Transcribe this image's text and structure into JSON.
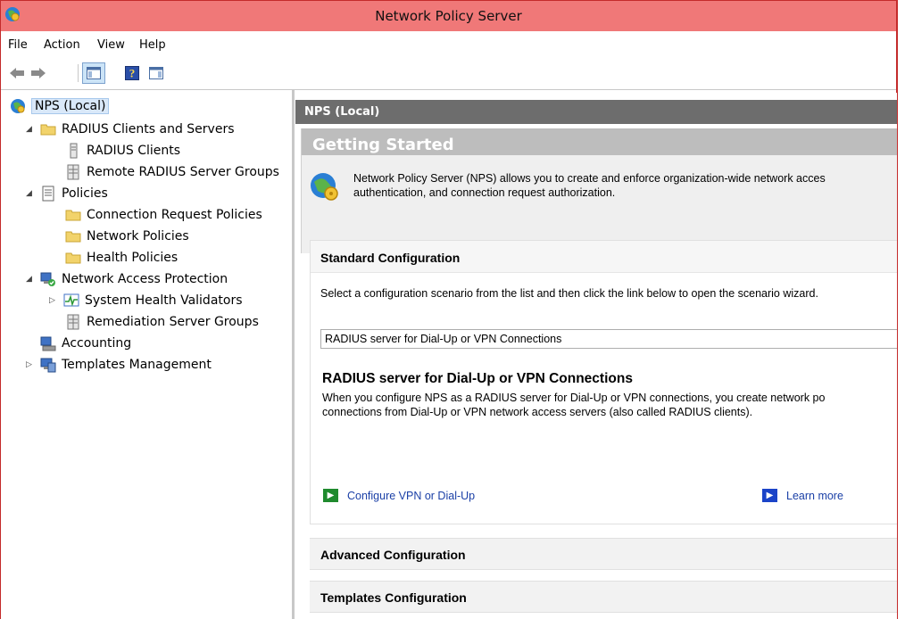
{
  "window": {
    "title": "Network Policy Server"
  },
  "menu": {
    "items": [
      "File",
      "Action",
      "View",
      "Help"
    ]
  },
  "toolbar": {
    "back": "back-arrow",
    "forward": "forward-arrow",
    "console_tree": "console-tree-toggle",
    "help": "help-icon",
    "action_pane": "action-pane-toggle"
  },
  "tree": {
    "root": "NPS (Local)",
    "items": [
      "RADIUS Clients and Servers",
      "RADIUS Clients",
      "Remote RADIUS Server Groups",
      "Policies",
      "Connection Request Policies",
      "Network Policies",
      "Health Policies",
      "Network Access Protection",
      "System Health Validators",
      "Remediation Server Groups",
      "Accounting",
      "Templates Management"
    ]
  },
  "main": {
    "header": "NPS (Local)",
    "getting_started": {
      "title": "Getting Started",
      "line1": "Network Policy Server (NPS) allows you to create and enforce organization-wide network acces",
      "line2": "authentication, and connection request authorization."
    },
    "standard": {
      "title": "Standard Configuration",
      "description": "Select a configuration scenario from the list and then click the link below to open the scenario wizard.",
      "selected_option": "RADIUS server for Dial-Up or VPN Connections",
      "subtitle": "RADIUS server for Dial-Up or VPN Connections",
      "body1": "When you configure NPS as a RADIUS server for Dial-Up or VPN connections, you create network po",
      "body2": "connections from Dial-Up or VPN network access servers (also called RADIUS clients).",
      "configure_link": "Configure VPN or Dial-Up",
      "learn_more_link": "Learn more"
    },
    "advanced": {
      "title": "Advanced Configuration"
    },
    "templates": {
      "title": "Templates Configuration"
    }
  },
  "colors": {
    "titlebar": "#f07878",
    "border": "#c42b2b",
    "header_gray": "#6d6d6d",
    "link": "#1a3fa6",
    "green_arrow": "#1f8a2e",
    "blue_arrow": "#1b44c8"
  }
}
